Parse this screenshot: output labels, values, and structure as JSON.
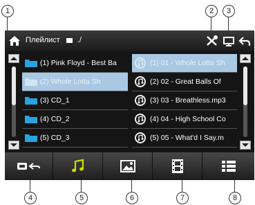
{
  "callouts": [
    "1",
    "2",
    "3",
    "4",
    "5",
    "6",
    "7",
    "8"
  ],
  "header": {
    "title": "Плейлист",
    "path": "./",
    "icons": [
      "home-icon",
      "tools-icon",
      "display-icon",
      "back-icon"
    ]
  },
  "left_list": {
    "items": [
      {
        "label": "(1) Pink Floyd - Best Ba",
        "selected": false
      },
      {
        "label": "(2) Whole Lotta Sh",
        "selected": true
      },
      {
        "label": "(3) CD_1",
        "selected": false
      },
      {
        "label": "(4) CD_2",
        "selected": false
      },
      {
        "label": "(5) CD_3",
        "selected": false
      }
    ]
  },
  "right_list": {
    "items": [
      {
        "label": "(1) 01 - Whole Lotta Sh",
        "selected": true
      },
      {
        "label": "(2) 02 - Great Balls Of",
        "selected": false
      },
      {
        "label": "(3) 03 - Breathless.mp3",
        "selected": false
      },
      {
        "label": "(4) 04 - High School Co",
        "selected": false
      },
      {
        "label": "(5) 05 - What'd I Say.m",
        "selected": false
      }
    ]
  },
  "toolbar": {
    "buttons": [
      "source-back-icon",
      "music-icon",
      "picture-icon",
      "video-icon",
      "list-menu-icon"
    ]
  },
  "colors": {
    "screen": "#151515",
    "selection": "#a9c8e3",
    "music_accent": "#c8e000",
    "picture_accent": "#c8e000"
  }
}
